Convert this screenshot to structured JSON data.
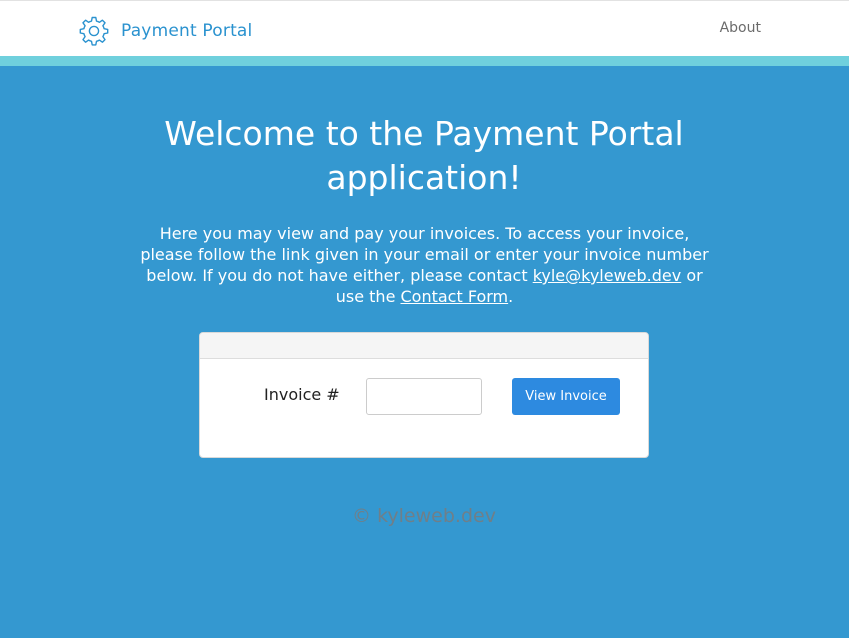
{
  "navbar": {
    "brand_icon": "gear-icon",
    "brand_text": "Payment Portal",
    "about_label": "About"
  },
  "main": {
    "headline": "Welcome to the Payment Portal application!",
    "intro_before_email": "Here you may view and pay your invoices. To access your invoice, please follow the link given in your email or enter your invoice number below. If you do not have either, please contact ",
    "email_link": "kyle@kyleweb.dev",
    "intro_between": " or use the ",
    "contact_link": "Contact Form",
    "intro_after": "."
  },
  "invoice_form": {
    "label": "Invoice #",
    "input_value": "",
    "button_label": "View Invoice"
  },
  "footer": {
    "text": "© kyleweb.dev"
  },
  "colors": {
    "background": "#3498d0",
    "accent_bar": "#6fd0dd",
    "brand": "#2a92cf",
    "button": "#2d8ae0"
  }
}
